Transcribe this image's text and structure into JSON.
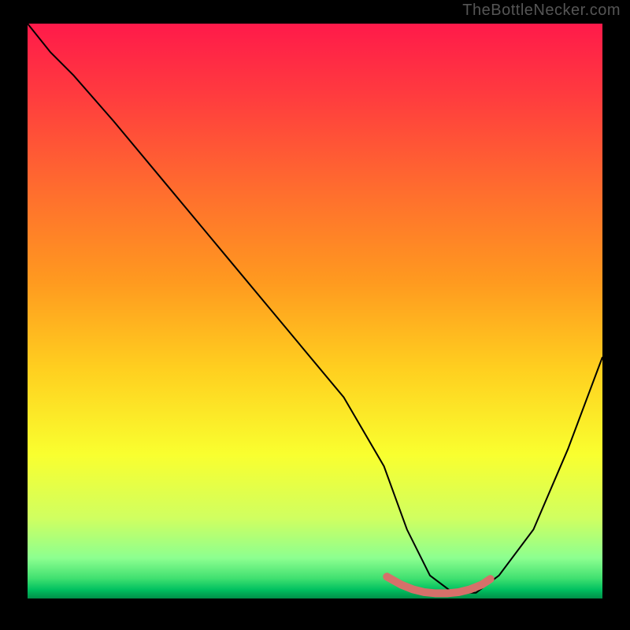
{
  "watermark": "TheBottleNecker.com",
  "chart_data": {
    "type": "line",
    "title": "",
    "xlabel": "",
    "ylabel": "",
    "xlim": [
      0,
      100
    ],
    "ylim": [
      0,
      100
    ],
    "gradient_stops": [
      {
        "offset": 0.0,
        "color": "#ff1a4a"
      },
      {
        "offset": 0.12,
        "color": "#ff3a3f"
      },
      {
        "offset": 0.28,
        "color": "#ff6a2f"
      },
      {
        "offset": 0.45,
        "color": "#ff9a1f"
      },
      {
        "offset": 0.6,
        "color": "#ffcf1f"
      },
      {
        "offset": 0.75,
        "color": "#f9ff2f"
      },
      {
        "offset": 0.86,
        "color": "#d0ff60"
      },
      {
        "offset": 0.93,
        "color": "#8cff90"
      },
      {
        "offset": 0.965,
        "color": "#40e070"
      },
      {
        "offset": 0.985,
        "color": "#00c060"
      },
      {
        "offset": 1.0,
        "color": "#009048"
      }
    ],
    "series": [
      {
        "name": "bottleneck-curve",
        "color": "#000000",
        "x": [
          0,
          4,
          8,
          15,
          25,
          35,
          45,
          55,
          62,
          66,
          70,
          74,
          78,
          82,
          88,
          94,
          100
        ],
        "y": [
          100,
          95,
          91,
          83,
          71,
          59,
          47,
          35,
          23,
          12,
          4,
          1,
          1,
          4,
          12,
          26,
          42
        ]
      }
    ],
    "highlight": {
      "name": "optimal-range",
      "color": "#d6706a",
      "x": [
        62.5,
        65,
        67,
        69,
        71,
        73,
        75,
        77,
        79,
        80.5
      ],
      "y": [
        3.8,
        2.4,
        1.6,
        1.1,
        0.9,
        0.9,
        1.1,
        1.6,
        2.4,
        3.4
      ]
    }
  }
}
